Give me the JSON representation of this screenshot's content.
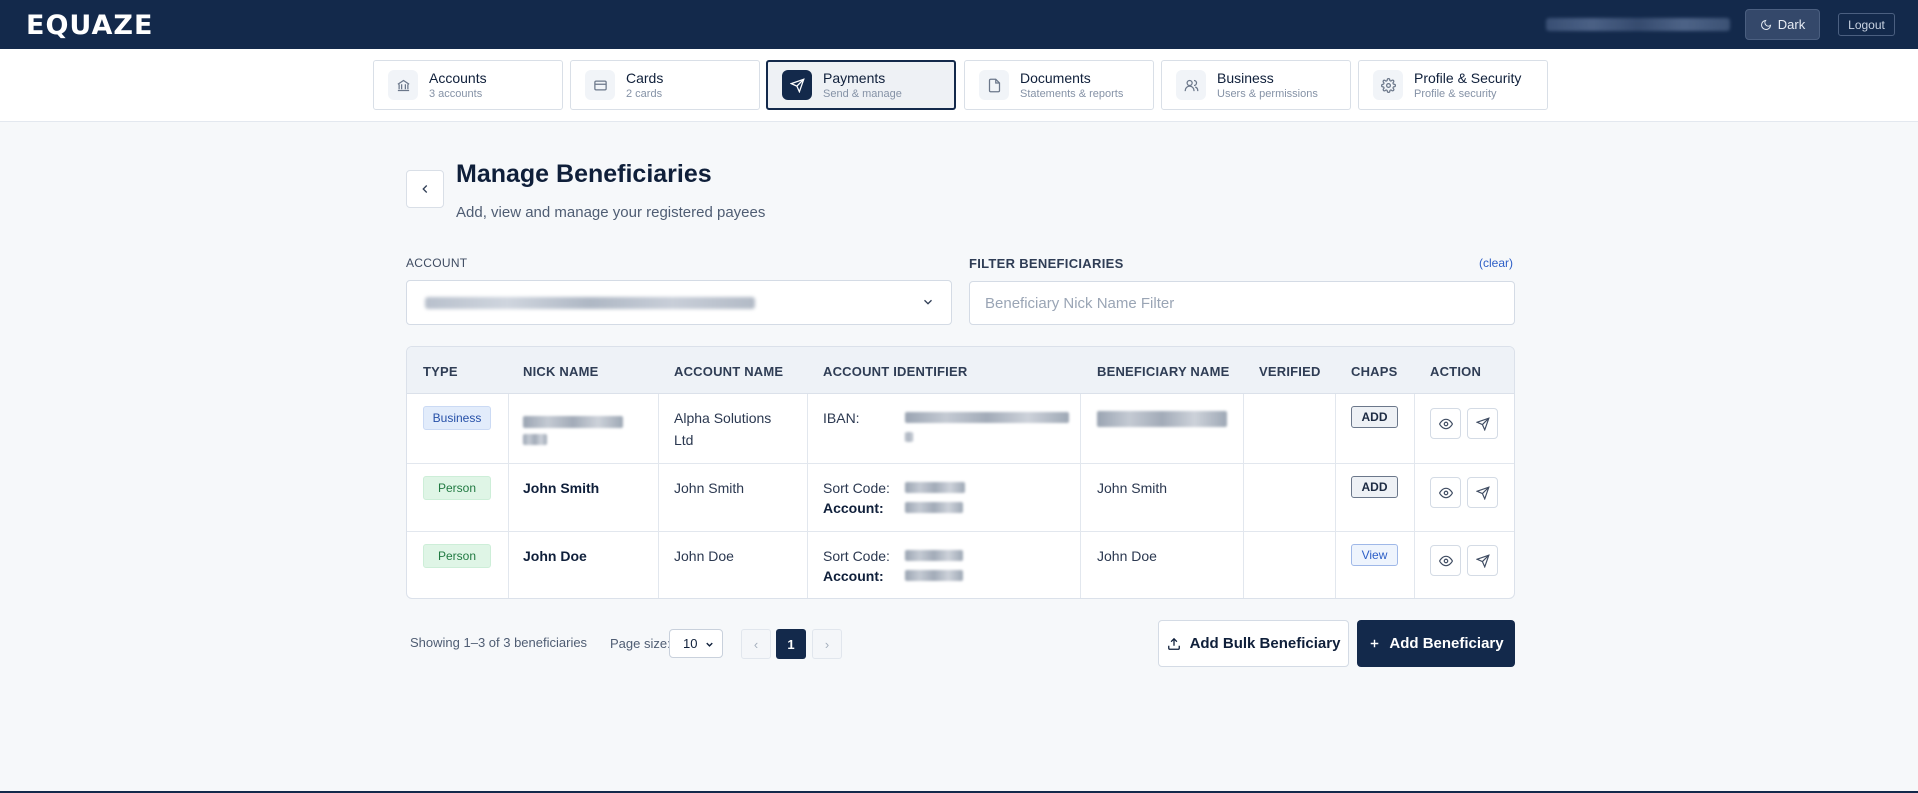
{
  "app": {
    "logo": "EQUAZE"
  },
  "header": {
    "theme_label": "Dark",
    "logout_label": "Logout"
  },
  "nav": {
    "tabs": [
      {
        "title": "Accounts",
        "subtitle": "3 accounts",
        "icon": "bank-icon",
        "active": false
      },
      {
        "title": "Cards",
        "subtitle": "2 cards",
        "icon": "card-icon",
        "active": false
      },
      {
        "title": "Payments",
        "subtitle": "Send & manage",
        "icon": "send-icon",
        "active": true
      },
      {
        "title": "Documents",
        "subtitle": "Statements & reports",
        "icon": "document-icon",
        "active": false
      },
      {
        "title": "Business",
        "subtitle": "Users & permissions",
        "icon": "users-icon",
        "active": false
      },
      {
        "title": "Profile & Security",
        "subtitle": "Profile & security",
        "icon": "gear-icon",
        "active": false
      }
    ]
  },
  "page": {
    "title": "Manage Beneficiaries",
    "subtitle": "Add, view and manage your registered payees"
  },
  "filters": {
    "account_label": "ACCOUNT",
    "filter_label": "FILTER BENEFICIARIES",
    "clear_label": "(clear)",
    "filter_placeholder": "Beneficiary Nick Name Filter"
  },
  "table": {
    "columns": [
      "TYPE",
      "NICK NAME",
      "ACCOUNT NAME",
      "ACCOUNT IDENTIFIER",
      "BENEFICIARY NAME",
      "VERIFIED",
      "CHAPS",
      "ACTION"
    ],
    "rows": [
      {
        "type": "Business",
        "nick_name": "",
        "account_name_line1": "Alpha Solutions",
        "account_name_line2": "Ltd",
        "id_label1": "IBAN:",
        "id_label2": "",
        "beneficiary_name": "",
        "verified": "",
        "chaps": "ADD"
      },
      {
        "type": "Person",
        "nick_name": "John Smith",
        "account_name_line1": "John Smith",
        "account_name_line2": "",
        "id_label1": "Sort Code:",
        "id_label2": "Account:",
        "beneficiary_name": "John Smith",
        "verified": "",
        "chaps": "ADD"
      },
      {
        "type": "Person",
        "nick_name": "John Doe",
        "account_name_line1": "John Doe",
        "account_name_line2": "",
        "id_label1": "Sort Code:",
        "id_label2": "Account:",
        "beneficiary_name": "John Doe",
        "verified": "",
        "chaps": "View"
      }
    ]
  },
  "footer": {
    "showing": "Showing 1–3 of 3 beneficiaries",
    "page_size_label": "Page size:",
    "page_size_value": "10",
    "prev": "‹",
    "current_page": "1",
    "next": "›",
    "bulk_label": "Add Bulk Beneficiary",
    "add_label": "Add Beneficiary"
  },
  "colors": {
    "brand": "#13294b",
    "business_badge": "#e2ecfb",
    "person_badge": "#dff5e6",
    "link": "#2d5fc7"
  }
}
